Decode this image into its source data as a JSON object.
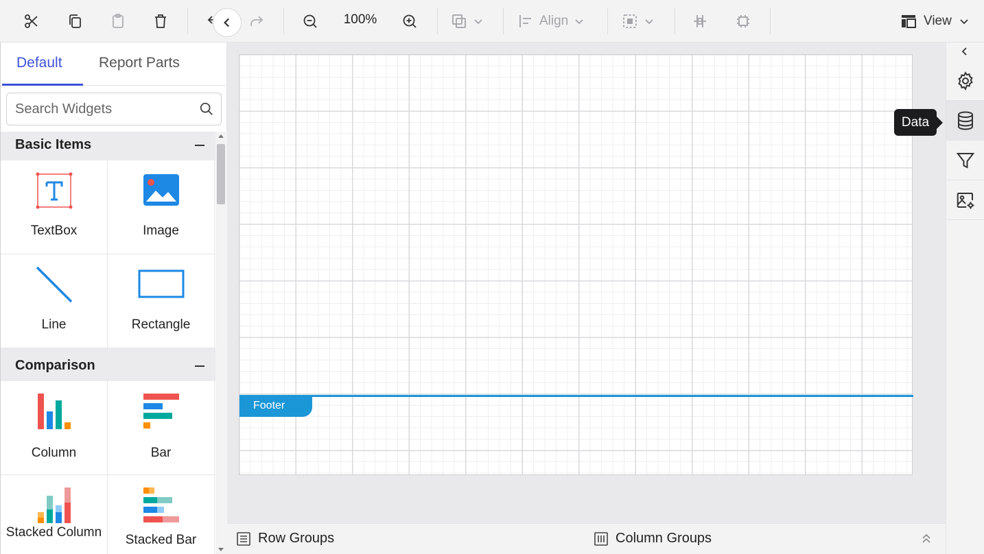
{
  "toolbar": {
    "zoom": "100%",
    "align_label": "Align",
    "view_label": "View"
  },
  "left_panel": {
    "tabs": [
      {
        "label": "Default",
        "active": true
      },
      {
        "label": "Report Parts",
        "active": false
      }
    ],
    "search_placeholder": "Search Widgets",
    "categories": [
      {
        "title": "Basic Items",
        "items": [
          {
            "label": "TextBox",
            "icon": "textbox-icon"
          },
          {
            "label": "Image",
            "icon": "image-icon"
          },
          {
            "label": "Line",
            "icon": "line-icon"
          },
          {
            "label": "Rectangle",
            "icon": "rectangle-icon"
          }
        ]
      },
      {
        "title": "Comparison",
        "items": [
          {
            "label": "Column",
            "icon": "column-chart-icon"
          },
          {
            "label": "Bar",
            "icon": "bar-chart-icon"
          },
          {
            "label": "Stacked Column",
            "icon": "stacked-column-chart-icon"
          },
          {
            "label": "Stacked Bar",
            "icon": "stacked-bar-chart-icon"
          }
        ]
      }
    ]
  },
  "design": {
    "footer_label": "Footer"
  },
  "groups": {
    "row_groups": "Row Groups",
    "column_groups": "Column Groups"
  },
  "right_panel": {
    "tooltip": "Data",
    "buttons": [
      "settings-icon",
      "data-icon",
      "filter-icon",
      "image-settings-icon"
    ]
  },
  "colors": {
    "accent": "#3f51d8",
    "footer": "#1b97d7",
    "widget_blue": "#1e88e5",
    "widget_red": "#ef5350"
  }
}
